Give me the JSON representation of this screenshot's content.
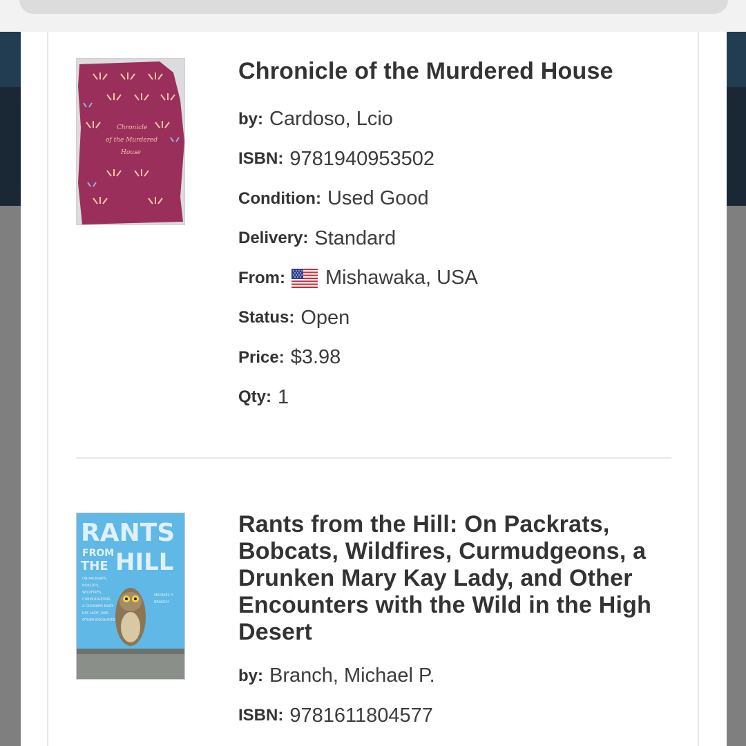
{
  "orders": [
    {
      "title": "Chronicle of the Murdered House",
      "by_label": "by:",
      "author": "Cardoso, Lcio",
      "isbn_label": "ISBN:",
      "isbn": "9781940953502",
      "condition_label": "Condition:",
      "condition": "Used Good",
      "delivery_label": "Delivery:",
      "delivery": "Standard",
      "from_label": "From:",
      "from_flag": "us-flag-icon",
      "from": "Mishawaka, USA",
      "status_label": "Status:",
      "status": "Open",
      "price_label": "Price:",
      "price": "$3.98",
      "qty_label": "Qty:",
      "qty": "1",
      "cover_color": "#9b2f5c"
    },
    {
      "title": "Rants from the Hill: On Packrats, Bobcats, Wildfires, Curmudgeons, a Drunken Mary Kay Lady, and Other Encounters with the Wild in the High Desert",
      "by_label": "by:",
      "author": "Branch, Michael P.",
      "isbn_label": "ISBN:",
      "isbn": "9781611804577",
      "cover_color": "#5fb8e6"
    }
  ],
  "colors": {
    "title": "#333333",
    "nav_bg": "#223c52",
    "overlay": "#7f7f7f"
  }
}
